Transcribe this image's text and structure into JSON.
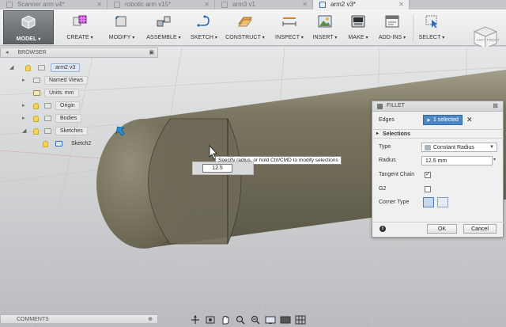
{
  "tabs": [
    {
      "label": "Scanner arm v4*",
      "active": false
    },
    {
      "label": "robotic arm v15*",
      "active": false
    },
    {
      "label": "arm3 v1",
      "active": false
    },
    {
      "label": "arm2 v3*",
      "active": true
    }
  ],
  "toolbar": {
    "model": "MODEL",
    "groups": [
      {
        "label": "CREATE",
        "icon": "create-icon"
      },
      {
        "label": "MODIFY",
        "icon": "modify-icon"
      },
      {
        "label": "ASSEMBLE",
        "icon": "assemble-icon"
      },
      {
        "label": "SKETCH",
        "icon": "sketch-icon"
      },
      {
        "label": "CONSTRUCT",
        "icon": "construct-icon"
      },
      {
        "label": "INSPECT",
        "icon": "inspect-icon"
      },
      {
        "label": "INSERT",
        "icon": "insert-icon"
      },
      {
        "label": "MAKE",
        "icon": "make-icon"
      },
      {
        "label": "ADD-INS",
        "icon": "add-ins-icon"
      },
      {
        "label": "SELECT",
        "icon": "select-icon"
      }
    ]
  },
  "viewcube": {
    "left": "LEFT",
    "front": "FRONT"
  },
  "browser": {
    "title": "BROWSER",
    "root": "arm2 v3",
    "items": [
      {
        "label": "Named Views"
      },
      {
        "label": "Units: mm"
      },
      {
        "label": "Origin"
      },
      {
        "label": "Bodies"
      },
      {
        "label": "Sketches"
      },
      {
        "label": "Sketch2"
      }
    ]
  },
  "comments": {
    "title": "COMMENTS"
  },
  "viewport": {
    "tooltip": "Specify radius, or hold Ctrl/CMD to modify selections",
    "radius_input": "12.5"
  },
  "fillet": {
    "title": "FILLET",
    "edges_label": "Edges",
    "edges_value": "1 selected",
    "section": "Selections",
    "type_label": "Type",
    "type_value": "Constant Radius",
    "radius_label": "Radius",
    "radius_value": "12.5 mm",
    "tangent_chain_label": "Tangent Chain",
    "tangent_chain_checked": true,
    "g2_label": "G2",
    "g2_checked": false,
    "corner_type_label": "Corner Type",
    "ok": "OK",
    "cancel": "Cancel"
  }
}
